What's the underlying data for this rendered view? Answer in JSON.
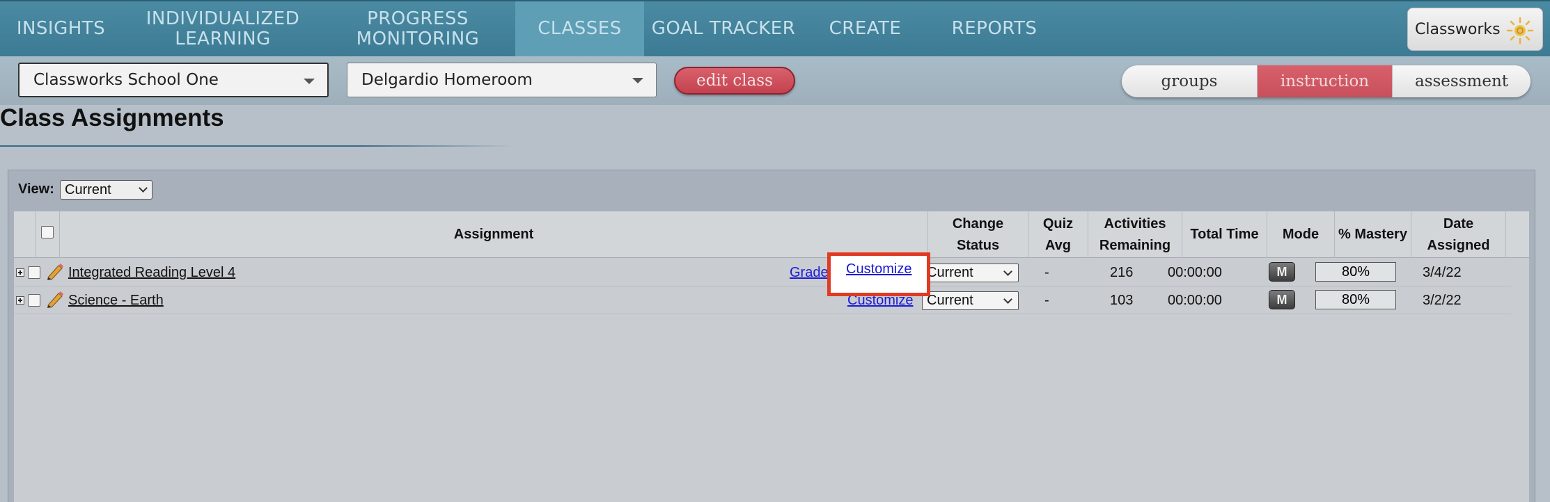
{
  "nav": {
    "items": [
      {
        "line1": "INSIGHTS",
        "line2": ""
      },
      {
        "line1": "INDIVIDUALIZED",
        "line2": "LEARNING"
      },
      {
        "line1": "PROGRESS",
        "line2": "MONITORING"
      },
      {
        "line1": "CLASSES",
        "line2": ""
      },
      {
        "line1": "GOAL TRACKER",
        "line2": ""
      },
      {
        "line1": "CREATE",
        "line2": ""
      },
      {
        "line1": "REPORTS",
        "line2": ""
      }
    ],
    "active": "CLASSES",
    "brand": "Classworks"
  },
  "subbar": {
    "school": "Classworks School One",
    "class": "Delgardio Homeroom",
    "edit_class": "edit class",
    "segments": [
      "groups",
      "instruction",
      "assessment"
    ],
    "active_segment": "instruction"
  },
  "page": {
    "title": "Class Assignments"
  },
  "view": {
    "label": "View:",
    "value": "Current"
  },
  "table": {
    "headers": {
      "assignment": "Assignment",
      "change_status_1": "Change",
      "change_status_2": "Status",
      "quiz_avg_1": "Quiz",
      "quiz_avg_2": "Avg",
      "activities_1": "Activities",
      "activities_2": "Remaining",
      "total_time": "Total Time",
      "mode": "Mode",
      "mastery": "% Mastery",
      "date_1": "Date",
      "date_2": "Assigned"
    },
    "rows": [
      {
        "name": "Integrated Reading Level 4",
        "grade_link": "Grade",
        "customize": "Customize",
        "status": "Current",
        "quiz_avg": "-",
        "activities": "216",
        "total_time": "00:00:00",
        "mode": "M",
        "mastery": "80%",
        "date": "3/4/22"
      },
      {
        "name": "Science - Earth",
        "grade_link": "",
        "customize": "Customize",
        "status": "Current",
        "quiz_avg": "-",
        "activities": "103",
        "total_time": "00:00:00",
        "mode": "M",
        "mastery": "80%",
        "date": "3/2/22"
      }
    ]
  },
  "colors": {
    "nav_bg": "#3d7b94",
    "nav_active": "#5e9fb6",
    "accent_red": "#c7505c",
    "highlight": "#e03a23",
    "link_blue": "#1a1ad6"
  }
}
